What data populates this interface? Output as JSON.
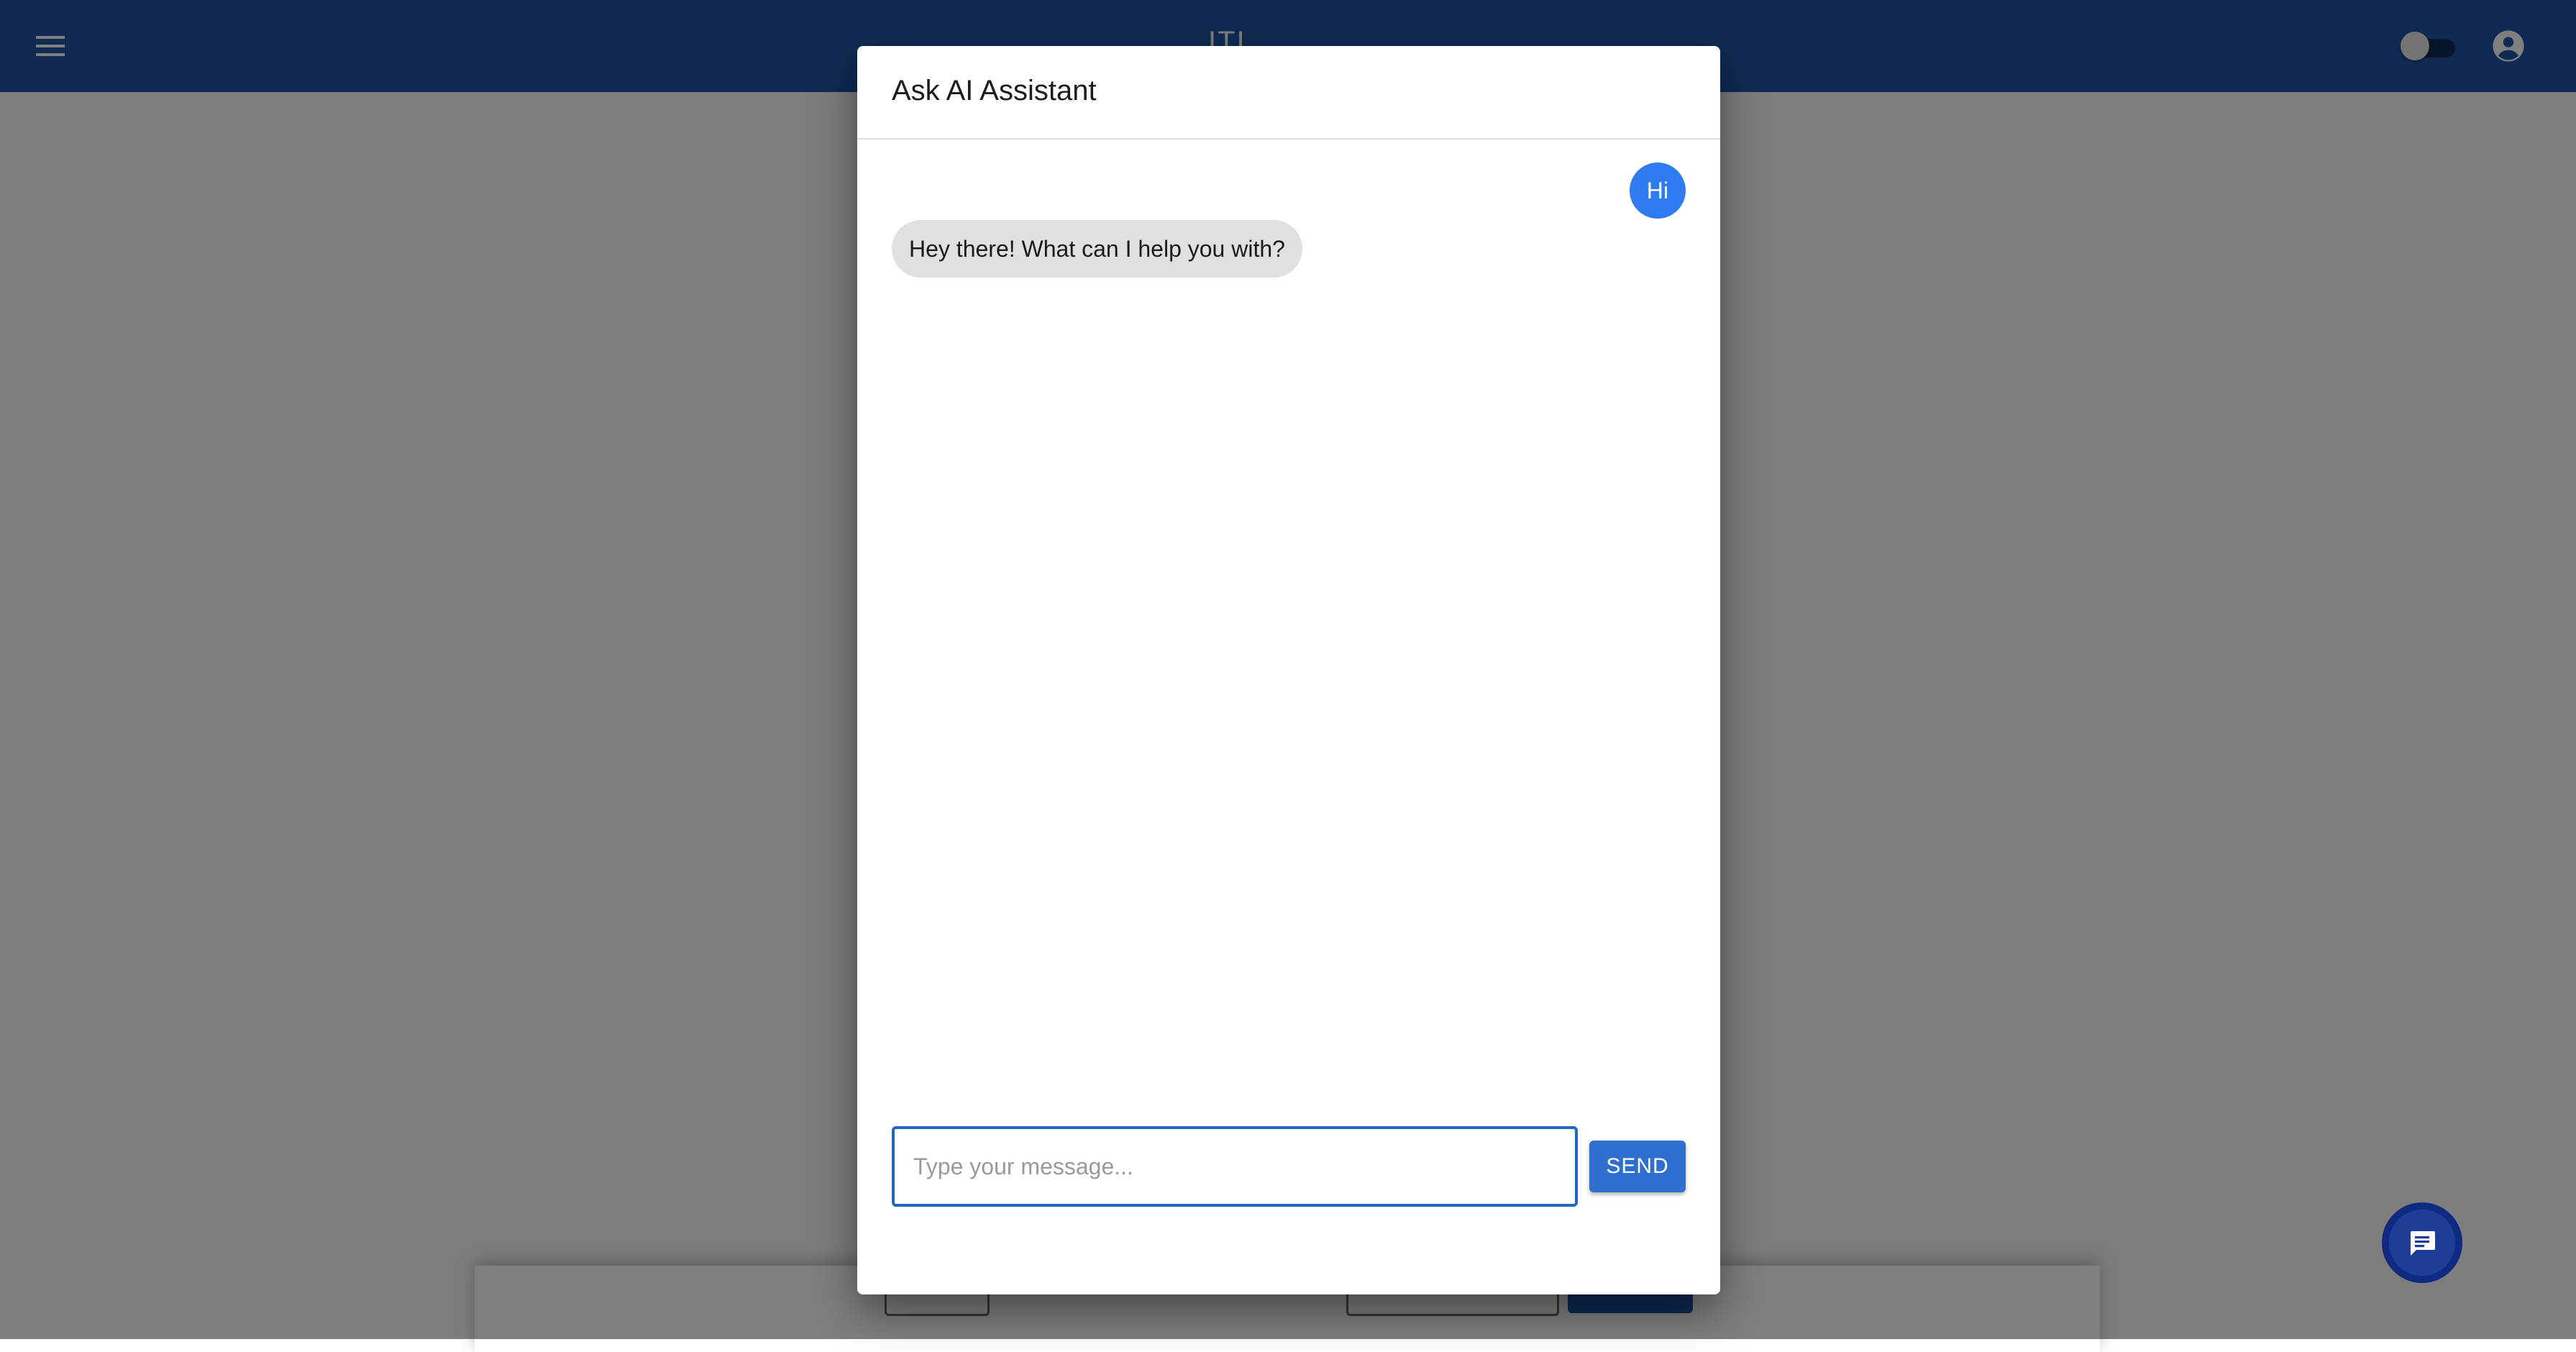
{
  "app": {
    "title": "ITI"
  },
  "dialog": {
    "title": "Ask AI Assistant",
    "messages": [
      {
        "sender": "user",
        "text": "Hi"
      },
      {
        "sender": "assistant",
        "text": "Hey there! What can I help you with?"
      }
    ],
    "input": {
      "placeholder": "Type your message...",
      "value": ""
    },
    "send_label": "SEND"
  },
  "icons": {
    "menu": "menu-icon",
    "theme_toggle": "theme-toggle-switch",
    "account": "account-circle-icon",
    "chat": "chat-icon"
  },
  "colors": {
    "app_bar": "#1f56a6",
    "user_bubble": "#2f7cf0",
    "assistant_bubble": "#e0e0e0",
    "send_button": "#2f6fd0",
    "input_border": "#2566c4",
    "chat_fab": "#1a3fa3"
  }
}
